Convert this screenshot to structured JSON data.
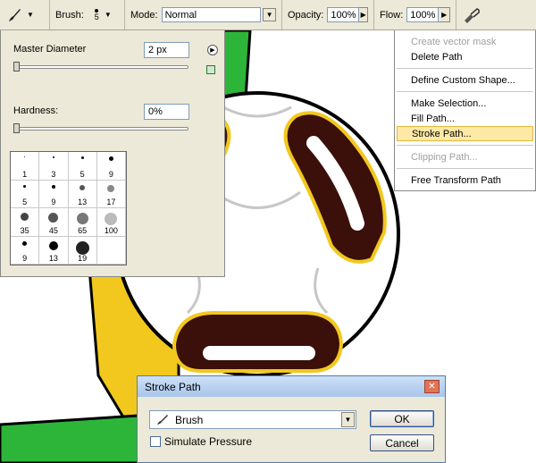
{
  "toolbar": {
    "brush_label": "Brush:",
    "brush_size": "5",
    "mode_label": "Mode:",
    "mode_value": "Normal",
    "opacity_label": "Opacity:",
    "opacity_value": "100%",
    "flow_label": "Flow:",
    "flow_value": "100%",
    "tool_icon": "brush-icon",
    "airbrush_icon": "airbrush-icon"
  },
  "brush_panel": {
    "master_diameter_label": "Master Diameter",
    "master_diameter_value": "2 px",
    "master_diameter_level": 0.02,
    "hardness_label": "Hardness:",
    "hardness_value": "0%",
    "hardness_level": 0,
    "presets": [
      {
        "size": "1"
      },
      {
        "size": "3"
      },
      {
        "size": "5"
      },
      {
        "size": "9"
      },
      {
        "size": "5"
      },
      {
        "size": "9"
      },
      {
        "size": "13"
      },
      {
        "size": "17"
      },
      {
        "size": "35"
      },
      {
        "size": "45"
      },
      {
        "size": "65"
      },
      {
        "size": "100"
      },
      {
        "size": "9"
      },
      {
        "size": "13"
      },
      {
        "size": "19"
      },
      {
        "size": ""
      }
    ]
  },
  "context_menu": {
    "items": [
      {
        "label": "Create vector mask",
        "disabled": true
      },
      {
        "label": "Delete Path",
        "disabled": false
      },
      {
        "label": "Define Custom Shape...",
        "disabled": false
      },
      {
        "label": "Make Selection...",
        "disabled": false
      },
      {
        "label": "Fill Path...",
        "disabled": false
      },
      {
        "label": "Stroke Path...",
        "disabled": false,
        "highlighted": true
      },
      {
        "label": "Clipping Path...",
        "disabled": true
      },
      {
        "label": "Free Transform Path",
        "disabled": false
      }
    ]
  },
  "dialog": {
    "title": "Stroke Path",
    "tool_value": "Brush",
    "simulate_pressure_label": "Simulate Pressure",
    "simulate_pressure_checked": false,
    "ok_label": "OK",
    "cancel_label": "Cancel"
  },
  "colors": {
    "yellow": "#f2c81e",
    "green": "#2db53a",
    "dark_red": "#3b0f0a",
    "dark_green": "#0f3a1f",
    "highlight": "#ffe9a6"
  }
}
